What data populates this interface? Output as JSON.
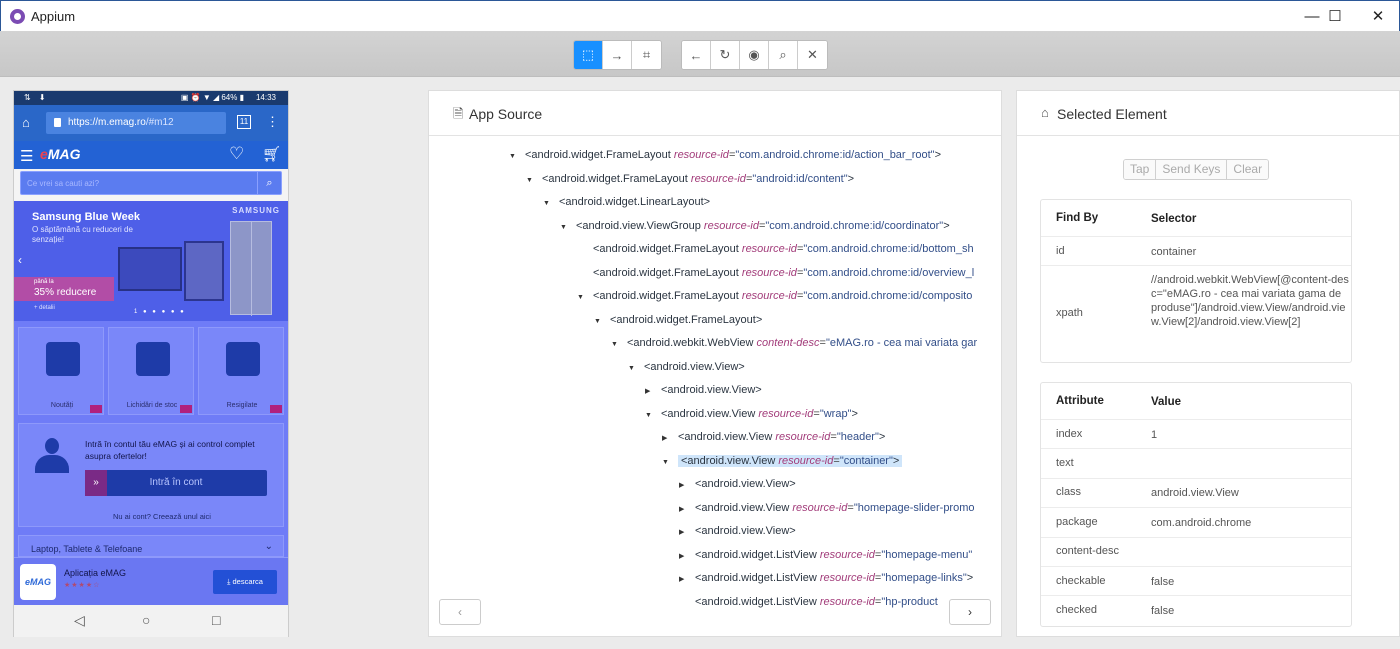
{
  "window": {
    "title": "Appium",
    "minimize": "—",
    "maximize": "☐",
    "close": "✕"
  },
  "toolbar": {
    "group1": [
      {
        "name": "select-elements-button",
        "icon": "⬚",
        "active": true
      },
      {
        "name": "swipe-button",
        "icon": "→",
        "active": false
      },
      {
        "name": "tap-by-coordinates-button",
        "icon": "⌗",
        "active": false
      }
    ],
    "group2": [
      {
        "name": "back-button",
        "icon": "←"
      },
      {
        "name": "refresh-button",
        "icon": "↻"
      },
      {
        "name": "start-recording-button",
        "icon": "◉"
      },
      {
        "name": "search-button",
        "icon": "⌕"
      },
      {
        "name": "quit-session-button",
        "icon": "✕"
      }
    ]
  },
  "device": {
    "status": {
      "left_icons": "⇅ ⬇",
      "battery": "▣ ⏰ ▼ ◢ 64% ▮",
      "time": "14:33"
    },
    "url": {
      "scheme": "https://",
      "host": "m.emag.ro",
      "path": "/#m12",
      "tabs": "11"
    },
    "logo_e": "e",
    "logo_rest": "MAG",
    "search_placeholder": "Ce vrei sa cauti azi?",
    "banner": {
      "title": "Samsung Blue Week",
      "subtitle": "O săptămână cu reduceri de senzație!",
      "brand": "SAMSUNG",
      "tag_small": "până la",
      "tag_big": "35% reducere",
      "tag_detail": "+ detalii",
      "dots": "1 ● ● ● ● ●"
    },
    "tiles": [
      "Noutăți",
      "Lichidări de stoc",
      "Resigilate"
    ],
    "login": {
      "text": "Intră în contul tău eMAG și ai control complet asupra ofertelor!",
      "button": "Intră în cont",
      "link": "Nu ai cont? Creează unul aici"
    },
    "category": "Laptop, Tablete & Telefoane",
    "app": {
      "logo": "eMAG",
      "name": "Aplicația eMAG",
      "stars": "★★★★☆",
      "download": "⤓ descarca"
    }
  },
  "app_source": {
    "title": "App Source",
    "nodes": [
      {
        "depth": 0,
        "tri": "▼",
        "tag": "<android.widget.FrameLayout",
        "attr": "resource-id",
        "val": "\"com.android.chrome:id/action_bar_root\"",
        "end": ">"
      },
      {
        "depth": 1,
        "tri": "▼",
        "tag": "<android.widget.FrameLayout",
        "attr": "resource-id",
        "val": "\"android:id/content\"",
        "end": ">"
      },
      {
        "depth": 2,
        "tri": "▼",
        "tag": "<android.widget.LinearLayout>",
        "attr": "",
        "val": "",
        "end": ""
      },
      {
        "depth": 3,
        "tri": "▼",
        "tag": "<android.view.ViewGroup",
        "attr": "resource-id",
        "val": "\"com.android.chrome:id/coordinator\"",
        "end": ">"
      },
      {
        "depth": 4,
        "tri": "",
        "tag": "<android.widget.FrameLayout",
        "attr": "resource-id",
        "val": "\"com.android.chrome:id/bottom_sh",
        "end": ""
      },
      {
        "depth": 4,
        "tri": "",
        "tag": "<android.widget.FrameLayout",
        "attr": "resource-id",
        "val": "\"com.android.chrome:id/overview_l",
        "end": ""
      },
      {
        "depth": 4,
        "tri": "▼",
        "tag": "<android.widget.FrameLayout",
        "attr": "resource-id",
        "val": "\"com.android.chrome:id/composito",
        "end": ""
      },
      {
        "depth": 5,
        "tri": "▼",
        "tag": "<android.widget.FrameLayout>",
        "attr": "",
        "val": "",
        "end": ""
      },
      {
        "depth": 6,
        "tri": "▼",
        "tag": "<android.webkit.WebView",
        "attr": "content-desc",
        "val": "\"eMAG.ro - cea mai variata gar",
        "end": ""
      },
      {
        "depth": 7,
        "tri": "▼",
        "tag": "<android.view.View>",
        "attr": "",
        "val": "",
        "end": ""
      },
      {
        "depth": 8,
        "tri": "▶",
        "tag": "<android.view.View>",
        "attr": "",
        "val": "",
        "end": ""
      },
      {
        "depth": 8,
        "tri": "▼",
        "tag": "<android.view.View",
        "attr": "resource-id",
        "val": "\"wrap\"",
        "end": ">"
      },
      {
        "depth": 9,
        "tri": "▶",
        "tag": "<android.view.View",
        "attr": "resource-id",
        "val": "\"header\"",
        "end": ">"
      },
      {
        "depth": 9,
        "tri": "▼",
        "tag": "<android.view.View",
        "attr": "resource-id",
        "val": "\"container\"",
        "end": ">",
        "selected": true
      },
      {
        "depth": 10,
        "tri": "▶",
        "tag": "<android.view.View>",
        "attr": "",
        "val": "",
        "end": ""
      },
      {
        "depth": 10,
        "tri": "▶",
        "tag": "<android.view.View",
        "attr": "resource-id",
        "val": "\"homepage-slider-promo",
        "end": ""
      },
      {
        "depth": 10,
        "tri": "▶",
        "tag": "<android.view.View>",
        "attr": "",
        "val": "",
        "end": ""
      },
      {
        "depth": 10,
        "tri": "▶",
        "tag": "<android.widget.ListView",
        "attr": "resource-id",
        "val": "\"homepage-menu\"",
        "end": ""
      },
      {
        "depth": 10,
        "tri": "▶",
        "tag": "<android.widget.ListView",
        "attr": "resource-id",
        "val": "\"homepage-links\"",
        "end": ">"
      },
      {
        "depth": 10,
        "tri": "",
        "tag": "<android.widget.ListView",
        "attr": "resource-id",
        "val": "\"hp-product",
        "end": ""
      }
    ],
    "prev": "‹",
    "next": "›"
  },
  "selected_element": {
    "title": "Selected Element",
    "actions": [
      "Tap",
      "Send Keys",
      "Clear"
    ],
    "find_by": {
      "headers": [
        "Find By",
        "Selector"
      ],
      "rows": [
        [
          "id",
          "container"
        ],
        [
          "xpath",
          "//android.webkit.WebView[@content-desc=\"eMAG.ro - cea mai variata gama de produse\"]/android.view.View/android.view.View[2]/android.view.View[2]"
        ]
      ]
    },
    "attributes": {
      "headers": [
        "Attribute",
        "Value"
      ],
      "rows": [
        [
          "index",
          "1"
        ],
        [
          "text",
          ""
        ],
        [
          "class",
          "android.view.View"
        ],
        [
          "package",
          "com.android.chrome"
        ],
        [
          "content-desc",
          ""
        ],
        [
          "checkable",
          "false"
        ],
        [
          "checked",
          "false"
        ]
      ]
    }
  }
}
